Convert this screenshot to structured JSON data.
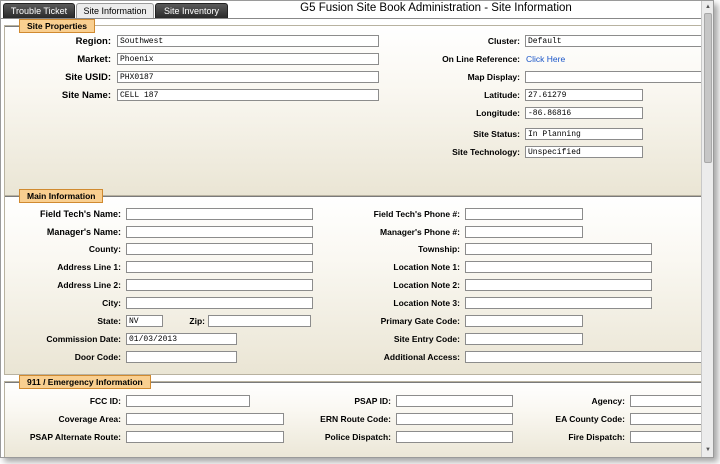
{
  "tabs": [
    "Trouble Ticket",
    "Site Information",
    "Site Inventory"
  ],
  "app_title": "G5 Fusion Site Book Administration - Site Information",
  "site_properties": {
    "legend": "Site Properties",
    "region": {
      "label": "Region:",
      "value": "Southwest"
    },
    "market": {
      "label": "Market:",
      "value": "Phoenix"
    },
    "site_usid": {
      "label": "Site USID:",
      "value": "PHX0187"
    },
    "site_name": {
      "label": "Site Name:",
      "value": "CELL 187"
    },
    "cluster": {
      "label": "Cluster:",
      "value": "Default"
    },
    "online_reference": {
      "label": "On Line Reference:",
      "link": "Click Here"
    },
    "map_display": {
      "label": "Map Display:",
      "value": ""
    },
    "latitude": {
      "label": "Latitude:",
      "value": "27.61279"
    },
    "longitude": {
      "label": "Longitude:",
      "value": "-86.86816"
    },
    "site_status": {
      "label": "Site Status:",
      "value": "In Planning"
    },
    "site_technology": {
      "label": "Site Technology:",
      "value": "Unspecified"
    }
  },
  "main_information": {
    "legend": "Main Information",
    "field_tech_name": {
      "label": "Field Tech's Name:",
      "value": ""
    },
    "manager_name": {
      "label": "Manager's Name:",
      "value": ""
    },
    "county": {
      "label": "County:",
      "value": ""
    },
    "address_line_1": {
      "label": "Address Line 1:",
      "value": ""
    },
    "address_line_2": {
      "label": "Address Line 2:",
      "value": ""
    },
    "city": {
      "label": "City:",
      "value": ""
    },
    "state": {
      "label": "State:",
      "value": "NV"
    },
    "zip": {
      "label": "Zip:",
      "value": ""
    },
    "commission_date": {
      "label": "Commission Date:",
      "value": "01/03/2013"
    },
    "door_code": {
      "label": "Door Code:",
      "value": ""
    },
    "field_tech_phone": {
      "label": "Field Tech's Phone #:",
      "value": ""
    },
    "manager_phone": {
      "label": "Manager's Phone #:",
      "value": ""
    },
    "township": {
      "label": "Township:",
      "value": ""
    },
    "location_note_1": {
      "label": "Location Note 1:",
      "value": ""
    },
    "location_note_2": {
      "label": "Location Note 2:",
      "value": ""
    },
    "location_note_3": {
      "label": "Location Note 3:",
      "value": ""
    },
    "primary_gate_code": {
      "label": "Primary Gate Code:",
      "value": ""
    },
    "site_entry_code": {
      "label": "Site Entry Code:",
      "value": ""
    },
    "additional_access": {
      "label": "Additional Access:",
      "value": ""
    }
  },
  "emergency_information": {
    "legend": "911 / Emergency Information",
    "fcc_id": {
      "label": "FCC ID:",
      "value": ""
    },
    "coverage_area": {
      "label": "Coverage Area:",
      "value": ""
    },
    "psap_alternate_route": {
      "label": "PSAP Alternate Route:",
      "value": ""
    },
    "psap_id": {
      "label": "PSAP ID:",
      "value": ""
    },
    "ern_route_code": {
      "label": "ERN Route Code:",
      "value": ""
    },
    "police_dispatch": {
      "label": "Police Dispatch:",
      "value": ""
    },
    "agency": {
      "label": "Agency:",
      "value": ""
    },
    "ea_county_code": {
      "label": "EA County Code:",
      "value": ""
    },
    "fire_dispatch": {
      "label": "Fire Dispatch:",
      "value": ""
    }
  }
}
